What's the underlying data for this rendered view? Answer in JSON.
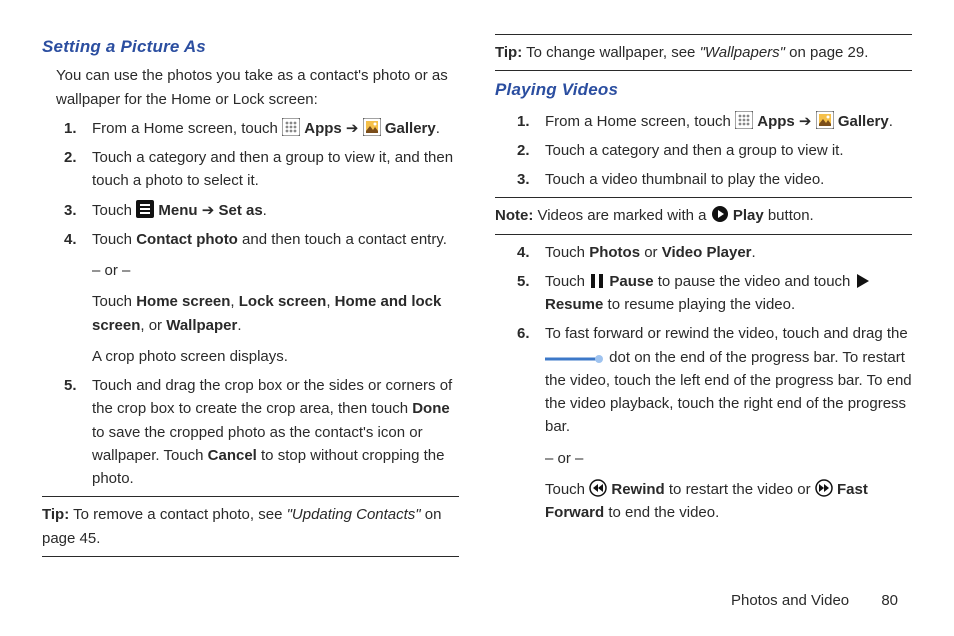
{
  "left": {
    "heading": "Setting a Picture As",
    "intro": "You can use the photos you take as a contact's photo or as wallpaper for the Home or Lock screen:",
    "s1_a": "From a Home screen, touch ",
    "s1_apps": "Apps",
    "s1_arrow": " ➔ ",
    "s1_gallery": "Gallery",
    "s1_end": ".",
    "s2": "Touch a category and then a group to view it, and then touch a photo to select it.",
    "s3_a": "Touch ",
    "s3_menu": "Menu",
    "s3_arrow": " ➔ ",
    "s3_setas": "Set as",
    "s3_end": ".",
    "s4_a": "Touch ",
    "s4_cp": "Contact photo",
    "s4_b": " and then touch a contact entry.",
    "s4_or": "– or –",
    "s4_sub_a": "Touch ",
    "s4_sub_home": "Home screen",
    "s4_sub_c1": ", ",
    "s4_sub_lock": "Lock screen",
    "s4_sub_c2": ", ",
    "s4_sub_hal": "Home and lock screen",
    "s4_sub_c3": ", or ",
    "s4_sub_wall": "Wallpaper",
    "s4_sub_end": ".",
    "s4_crop": "A crop photo screen displays.",
    "s5_a": "Touch and drag the crop box or the sides or corners of the crop box to create the crop area, then touch ",
    "s5_done": "Done",
    "s5_b": " to save the cropped photo as the contact's icon or wallpaper. Touch ",
    "s5_cancel": "Cancel",
    "s5_c": " to stop without cropping the photo.",
    "tip_lead": "Tip:",
    "tip_a": " To remove a contact photo, see ",
    "tip_ref": "\"Updating Contacts\"",
    "tip_b": " on page 45."
  },
  "right": {
    "tip_lead": "Tip:",
    "tip_a": " To change wallpaper, see ",
    "tip_ref": "\"Wallpapers\"",
    "tip_b": " on page 29.",
    "heading": "Playing Videos",
    "s1_a": "From a Home screen, touch ",
    "s1_apps": "Apps",
    "s1_arrow": " ➔ ",
    "s1_gallery": "Gallery",
    "s1_end": ".",
    "s2": "Touch a category and then a group to view it.",
    "s3": "Touch a video thumbnail to play the video.",
    "note_lead": "Note:",
    "note_a": " Videos are marked with a ",
    "note_play": "Play",
    "note_b": " button.",
    "s4_a": "Touch ",
    "s4_photos": "Photos",
    "s4_or": " or ",
    "s4_vp": "Video Player",
    "s4_end": ".",
    "s5_a": "Touch ",
    "s5_pause": "Pause",
    "s5_b": " to pause the video and touch ",
    "s5_resume": "Resume",
    "s5_c": " to resume playing the video.",
    "s6_a": "To fast forward or rewind the video, touch and drag the ",
    "s6_b": " dot on the end of the progress bar. To restart the video, touch the left end of the progress bar. To end the video playback, touch the right end of the progress bar.",
    "s6_or": "– or –",
    "s6_sub_a": "Touch ",
    "s6_rewind": "Rewind",
    "s6_sub_b": " to restart the video or ",
    "s6_ff": "Fast Forward",
    "s6_sub_c": " to end the video."
  },
  "footer": {
    "chapter": "Photos and Video",
    "page": "80"
  }
}
